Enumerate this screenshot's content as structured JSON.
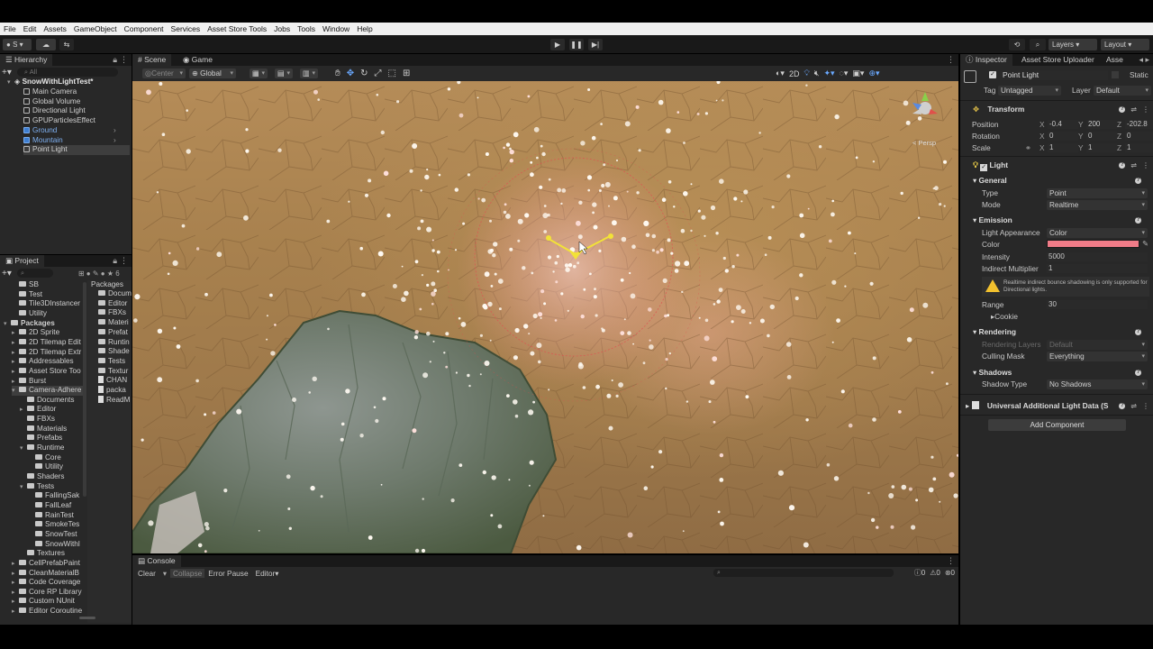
{
  "menu": [
    "File",
    "Edit",
    "Assets",
    "GameObject",
    "Component",
    "Services",
    "Asset Store Tools",
    "Jobs",
    "Tools",
    "Window",
    "Help"
  ],
  "toolbar": {
    "account": "S",
    "layers": "Layers",
    "layout": "Layout"
  },
  "hierarchy": {
    "title": "Hierarchy",
    "search_placeholder": "All",
    "scene_name": "SnowWithLightTest*",
    "items": [
      "Main Camera",
      "Global Volume",
      "Directional Light",
      "GPUParticlesEffect",
      "Ground",
      "Mountain",
      "Point Light"
    ]
  },
  "project": {
    "title": "Project",
    "tree": [
      {
        "label": "SB",
        "indent": 1,
        "arrow": ""
      },
      {
        "label": "Test",
        "indent": 1,
        "arrow": ""
      },
      {
        "label": "Tile3DInstancer",
        "indent": 1,
        "arrow": ""
      },
      {
        "label": "Utility",
        "indent": 1,
        "arrow": ""
      },
      {
        "label": "Packages",
        "indent": 0,
        "arrow": "▾",
        "bold": true
      },
      {
        "label": "2D Sprite",
        "indent": 1,
        "arrow": "▸"
      },
      {
        "label": "2D Tilemap Edit",
        "indent": 1,
        "arrow": "▸"
      },
      {
        "label": "2D Tilemap Extr",
        "indent": 1,
        "arrow": "▸"
      },
      {
        "label": "Addressables",
        "indent": 1,
        "arrow": "▸"
      },
      {
        "label": "Asset Store Too",
        "indent": 1,
        "arrow": "▸"
      },
      {
        "label": "Burst",
        "indent": 1,
        "arrow": "▸"
      },
      {
        "label": "Camera-Adhere",
        "indent": 1,
        "arrow": "▾",
        "selected": true
      },
      {
        "label": "Documents",
        "indent": 2,
        "arrow": ""
      },
      {
        "label": "Editor",
        "indent": 2,
        "arrow": "▸"
      },
      {
        "label": "FBXs",
        "indent": 2,
        "arrow": ""
      },
      {
        "label": "Materials",
        "indent": 2,
        "arrow": ""
      },
      {
        "label": "Prefabs",
        "indent": 2,
        "arrow": ""
      },
      {
        "label": "Runtime",
        "indent": 2,
        "arrow": "▾"
      },
      {
        "label": "Core",
        "indent": 3,
        "arrow": ""
      },
      {
        "label": "Utility",
        "indent": 3,
        "arrow": ""
      },
      {
        "label": "Shaders",
        "indent": 2,
        "arrow": ""
      },
      {
        "label": "Tests",
        "indent": 2,
        "arrow": "▾"
      },
      {
        "label": "FallingSak",
        "indent": 3,
        "arrow": ""
      },
      {
        "label": "FallLeaf",
        "indent": 3,
        "arrow": ""
      },
      {
        "label": "RainTest",
        "indent": 3,
        "arrow": ""
      },
      {
        "label": "SmokeTes",
        "indent": 3,
        "arrow": ""
      },
      {
        "label": "SnowTest",
        "indent": 3,
        "arrow": ""
      },
      {
        "label": "SnowWithl",
        "indent": 3,
        "arrow": ""
      },
      {
        "label": "Textures",
        "indent": 2,
        "arrow": ""
      },
      {
        "label": "CellPrefabPaint",
        "indent": 1,
        "arrow": "▸"
      },
      {
        "label": "CleanMaterialB",
        "indent": 1,
        "arrow": "▸"
      },
      {
        "label": "Code Coverage",
        "indent": 1,
        "arrow": "▸"
      },
      {
        "label": "Core RP Library",
        "indent": 1,
        "arrow": "▸"
      },
      {
        "label": "Custom NUnit",
        "indent": 1,
        "arrow": "▸"
      },
      {
        "label": "Editor Coroutine",
        "indent": 1,
        "arrow": "▸"
      }
    ],
    "breadcrumb": "Packages",
    "files": [
      {
        "label": "Docum",
        "kind": "folder"
      },
      {
        "label": "Editor",
        "kind": "folder"
      },
      {
        "label": "FBXs",
        "kind": "folder"
      },
      {
        "label": "Materi",
        "kind": "folder"
      },
      {
        "label": "Prefat",
        "kind": "folder"
      },
      {
        "label": "Runtin",
        "kind": "folder"
      },
      {
        "label": "Shade",
        "kind": "folder"
      },
      {
        "label": "Tests",
        "kind": "folder"
      },
      {
        "label": "Textur",
        "kind": "folder"
      },
      {
        "label": "CHAN",
        "kind": "file"
      },
      {
        "label": "packa",
        "kind": "file"
      },
      {
        "label": "ReadM",
        "kind": "file"
      }
    ]
  },
  "scene": {
    "tabs": [
      "Scene",
      "Game"
    ],
    "center_label": "Center",
    "global_label": "Global",
    "mode_2d": "2D",
    "persp_label": "< Persp"
  },
  "console": {
    "title": "Console",
    "clear": "Clear",
    "collapse": "Collapse",
    "error_pause": "Error Pause",
    "editor": "Editor",
    "counts": [
      "0",
      "0",
      "0"
    ]
  },
  "inspector": {
    "tabs": [
      "Inspector",
      "Asset Store Uploader",
      "Asse"
    ],
    "object_name": "Point Light",
    "static_label": "Static",
    "tag_label": "Tag",
    "tag_value": "Untagged",
    "layer_label": "Layer",
    "layer_value": "Default",
    "transform": {
      "title": "Transform",
      "position_label": "Position",
      "position": [
        "-0.4",
        "200",
        "-202.8"
      ],
      "rotation_label": "Rotation",
      "rotation": [
        "0",
        "0",
        "0"
      ],
      "scale_label": "Scale",
      "scale": [
        "1",
        "1",
        "1"
      ]
    },
    "light": {
      "title": "Light",
      "general": "General",
      "type_label": "Type",
      "type_value": "Point",
      "mode_label": "Mode",
      "mode_value": "Realtime",
      "emission": "Emission",
      "appearance_label": "Light Appearance",
      "appearance_value": "Color",
      "color_label": "Color",
      "color_value": "#f07c88",
      "intensity_label": "Intensity",
      "intensity_value": "5000",
      "indirect_label": "Indirect Multiplier",
      "indirect_value": "1",
      "warning": "Realtime indirect bounce shadowing is only supported for Directional lights.",
      "range_label": "Range",
      "range_value": "30",
      "cookie_label": "Cookie",
      "rendering": "Rendering",
      "rendering_layers_label": "Rendering Layers",
      "rendering_layers_value": "Default",
      "culling_label": "Culling Mask",
      "culling_value": "Everything",
      "shadows": "Shadows",
      "shadow_type_label": "Shadow Type",
      "shadow_type_value": "No Shadows"
    },
    "additional": "Universal Additional Light Data (S",
    "add_component": "Add Component"
  }
}
